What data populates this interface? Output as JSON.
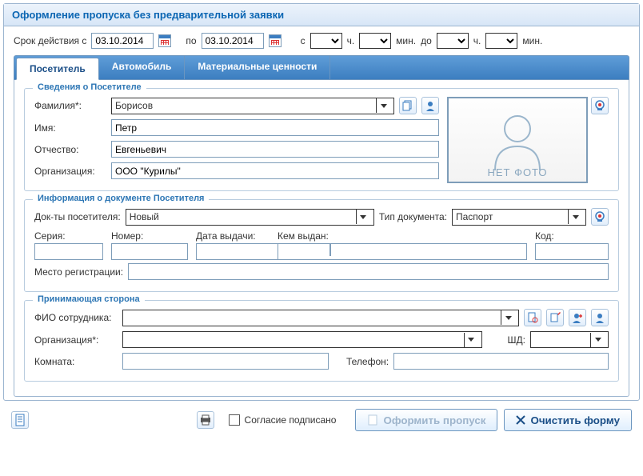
{
  "header": {
    "title": "Оформление пропуска без предварительной заявки"
  },
  "validity": {
    "prefix": "Срок действия с",
    "date_from": "03.10.2014",
    "to_label": "по",
    "date_to": "03.10.2014",
    "from_time_label": "с",
    "hour_suffix": "ч.",
    "min_suffix": "мин.",
    "until": "до"
  },
  "tabs": [
    {
      "label": "Посетитель",
      "active": true
    },
    {
      "label": "Автомобиль",
      "active": false
    },
    {
      "label": "Материальные ценности",
      "active": false
    }
  ],
  "visitor": {
    "legend": "Сведения о Посетителе",
    "lastname_label": "Фамилия*:",
    "lastname": "Борисов",
    "firstname_label": "Имя:",
    "firstname": "Петр",
    "middlename_label": "Отчество:",
    "middlename": "Евгеньевич",
    "org_label": "Организация:",
    "org": "ООО \"Курилы\"",
    "photo_caption": "НЕТ ФОТО"
  },
  "document": {
    "legend": "Информация о документе Посетителя",
    "docs_label": "Док-ты посетителя:",
    "docs_value": "Новый",
    "doctype_label": "Тип документа:",
    "doctype_value": "Паспорт",
    "series_label": "Серия:",
    "series": "",
    "number_label": "Номер:",
    "number": "",
    "issue_date_label": "Дата выдачи:",
    "issue_date": "",
    "issued_by_label": "Кем выдан:",
    "issued_by": "",
    "code_label": "Код:",
    "code": "",
    "reg_label": "Место регистрации:",
    "reg": ""
  },
  "host": {
    "legend": "Принимающая сторона",
    "fio_label": "ФИО сотрудника:",
    "fio": "",
    "org_label": "Организация*:",
    "org": "",
    "shd_label": "ШД:",
    "shd": "",
    "room_label": "Комната:",
    "room": "",
    "phone_label": "Телефон:",
    "phone": ""
  },
  "footer": {
    "consent": "Согласие подписано",
    "submit": "Оформить пропуск",
    "clear": "Очистить форму"
  }
}
